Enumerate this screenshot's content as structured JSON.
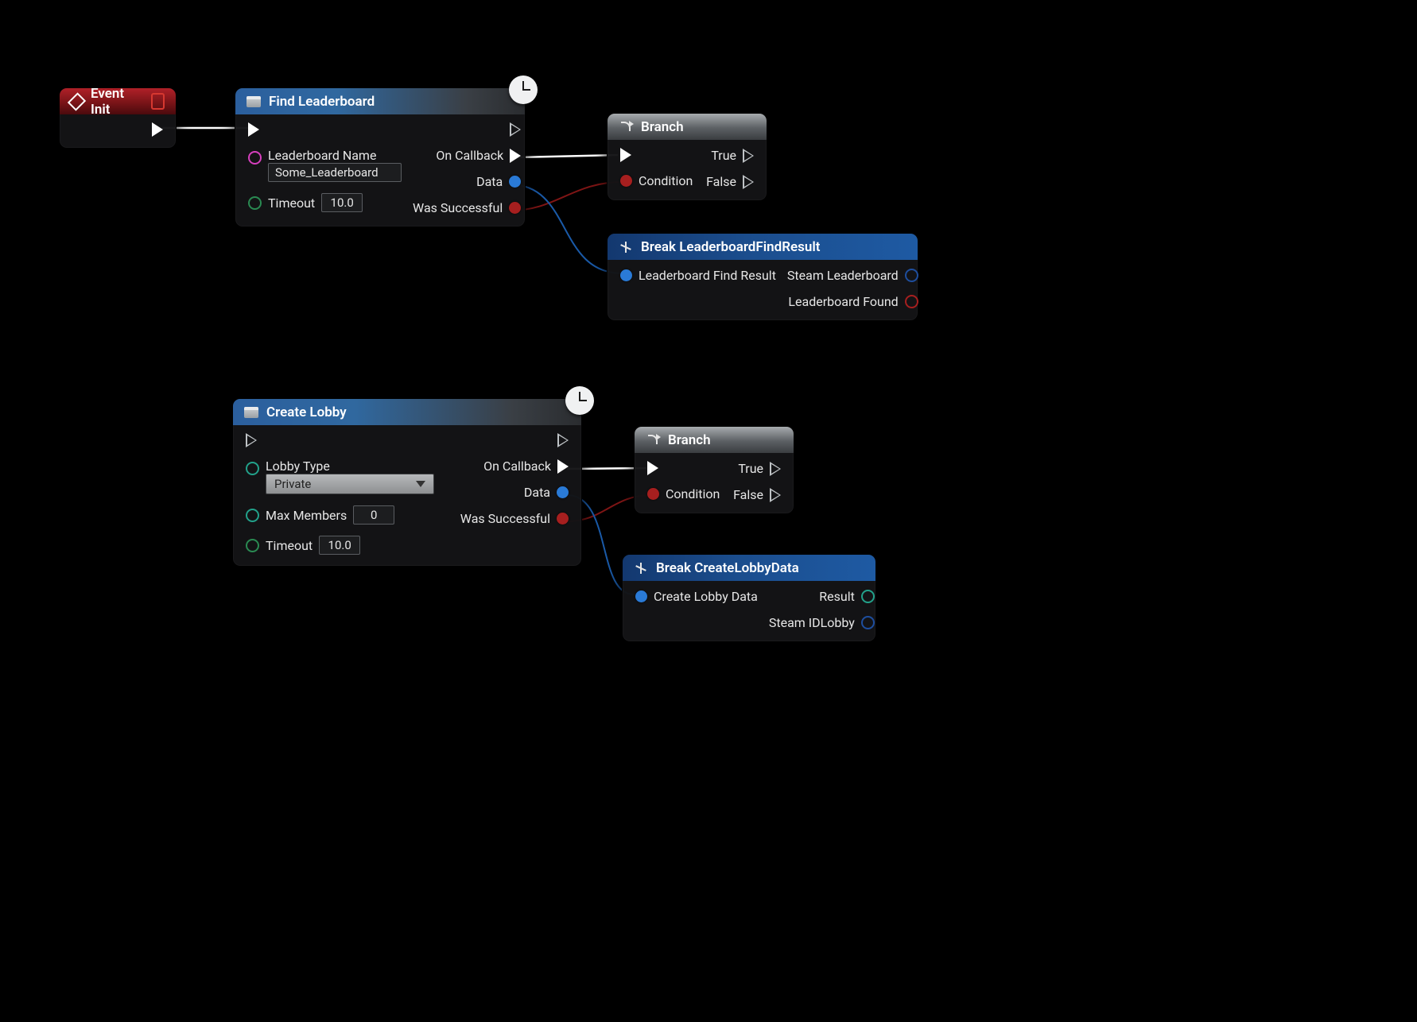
{
  "event_init": {
    "title": "Event Init"
  },
  "find_leaderboard": {
    "title": "Find Leaderboard",
    "in_name_label": "Leaderboard Name",
    "in_name_value": "Some_Leaderboard",
    "in_timeout_label": "Timeout",
    "in_timeout_value": "10.0",
    "out_callback": "On Callback",
    "out_data": "Data",
    "out_success": "Was Successful"
  },
  "branch1": {
    "title": "Branch",
    "in_cond": "Condition",
    "out_true": "True",
    "out_false": "False"
  },
  "break1": {
    "title": "Break LeaderboardFindResult",
    "in_label": "Leaderboard Find Result",
    "out1": "Steam Leaderboard",
    "out2": "Leaderboard Found"
  },
  "create_lobby": {
    "title": "Create Lobby",
    "in_type_label": "Lobby Type",
    "in_type_value": "Private",
    "in_max_label": "Max Members",
    "in_max_value": "0",
    "in_timeout_label": "Timeout",
    "in_timeout_value": "10.0",
    "out_callback": "On Callback",
    "out_data": "Data",
    "out_success": "Was Successful"
  },
  "branch2": {
    "title": "Branch",
    "in_cond": "Condition",
    "out_true": "True",
    "out_false": "False"
  },
  "break2": {
    "title": "Break CreateLobbyData",
    "in_label": "Create Lobby Data",
    "out1": "Result",
    "out2": "Steam IDLobby"
  }
}
